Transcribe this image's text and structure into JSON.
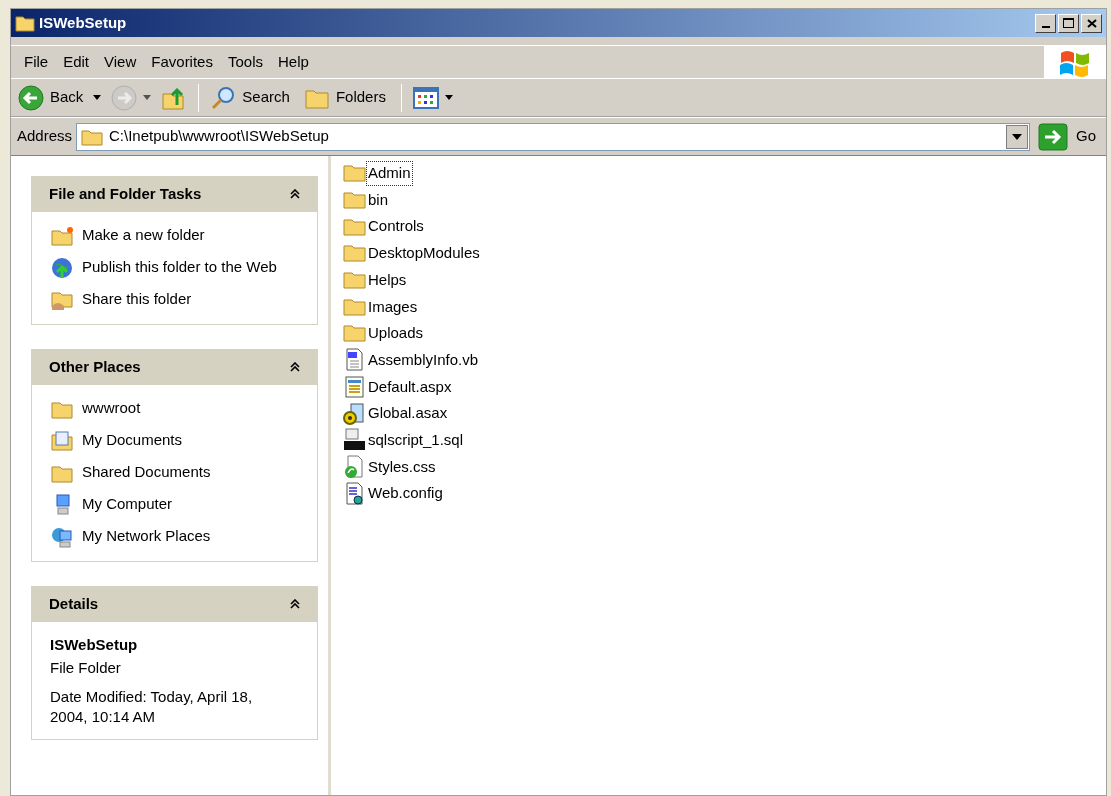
{
  "window": {
    "title": "ISWebSetup"
  },
  "menu": [
    "File",
    "Edit",
    "View",
    "Favorites",
    "Tools",
    "Help"
  ],
  "toolbar": [
    {
      "kind": "back",
      "label": "Back",
      "disabled": false
    },
    {
      "kind": "forward",
      "disabled": true
    },
    {
      "kind": "up",
      "disabled": false
    },
    {
      "kind": "search",
      "label": "Search",
      "disabled": false
    },
    {
      "kind": "folders",
      "label": "Folders",
      "disabled": false
    },
    {
      "kind": "views",
      "disabled": false
    }
  ],
  "address": {
    "label": "Address",
    "value": "C:\\Inetpub\\wwwroot\\ISWebSetup",
    "go": "Go"
  },
  "panels": [
    {
      "kind": "links",
      "title": "File and Folder Tasks",
      "items": [
        {
          "kind": "newfolder",
          "label": "Make a new folder"
        },
        {
          "kind": "publish",
          "label": "Publish this folder to the Web"
        },
        {
          "kind": "share",
          "label": "Share this folder"
        }
      ]
    },
    {
      "kind": "links",
      "title": "Other Places",
      "items": [
        {
          "kind": "folder",
          "label": "wwwroot"
        },
        {
          "kind": "documents",
          "label": "My Documents"
        },
        {
          "kind": "folder",
          "label": "Shared Documents"
        },
        {
          "kind": "computer",
          "label": "My Computer"
        },
        {
          "kind": "network",
          "label": "My Network Places"
        }
      ]
    },
    {
      "kind": "details",
      "title": "Details",
      "name": "ISWebSetup",
      "type": "File Folder",
      "modified": "Date Modified: Today, April 18, 2004, 10:14 AM"
    }
  ],
  "files": [
    {
      "kind": "folder",
      "name": "Admin",
      "selected": true
    },
    {
      "kind": "folder",
      "name": "bin",
      "selected": false
    },
    {
      "kind": "folder",
      "name": "Controls",
      "selected": false
    },
    {
      "kind": "folder",
      "name": "DesktopModules",
      "selected": false
    },
    {
      "kind": "folder",
      "name": "Helps",
      "selected": false
    },
    {
      "kind": "folder",
      "name": "Images",
      "selected": false
    },
    {
      "kind": "folder",
      "name": "Uploads",
      "selected": false
    },
    {
      "kind": "vb",
      "name": "AssemblyInfo.vb",
      "selected": false
    },
    {
      "kind": "aspx",
      "name": "Default.aspx",
      "selected": false
    },
    {
      "kind": "asax",
      "name": "Global.asax",
      "selected": false
    },
    {
      "kind": "sql",
      "name": "sqlscript_1.sql",
      "selected": false
    },
    {
      "kind": "css",
      "name": "Styles.css",
      "selected": false
    },
    {
      "kind": "config",
      "name": "Web.config",
      "selected": false
    }
  ]
}
